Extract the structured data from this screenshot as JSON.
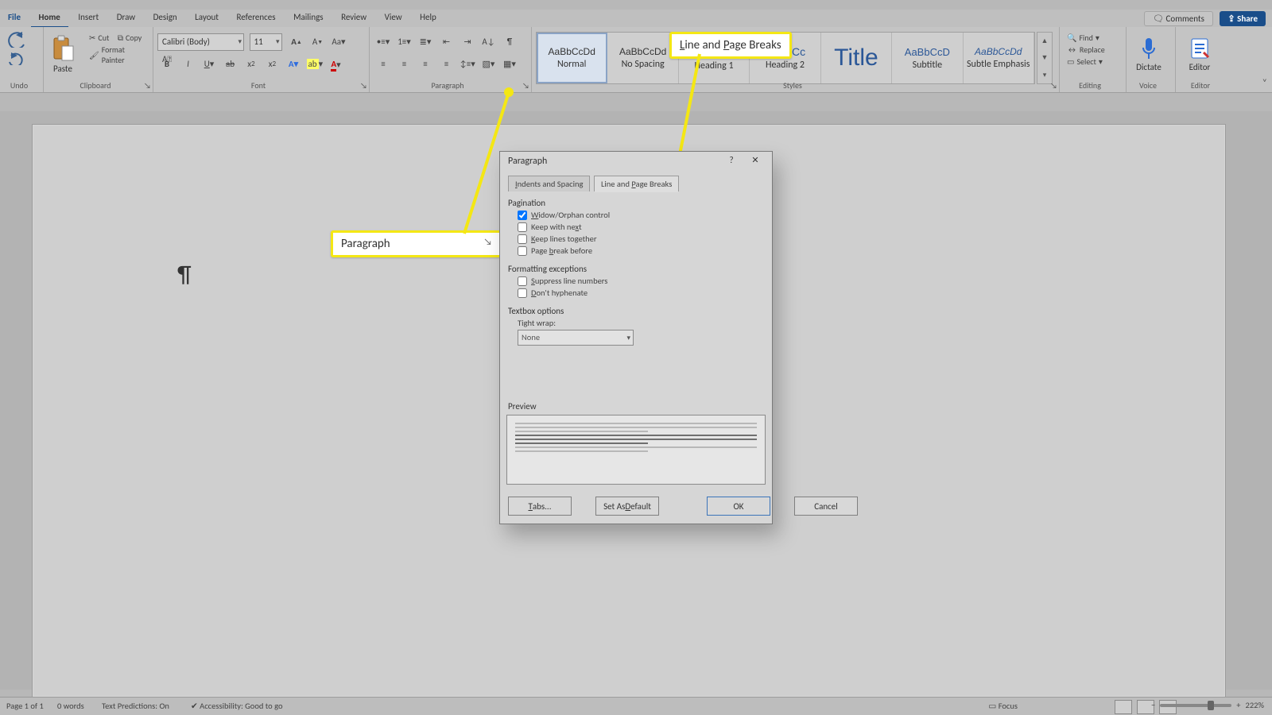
{
  "menu": {
    "file": "File",
    "home": "Home",
    "insert": "Insert",
    "draw": "Draw",
    "design": "Design",
    "layout": "Layout",
    "references": "References",
    "mailings": "Mailings",
    "review": "Review",
    "view": "View",
    "help": "Help"
  },
  "top_actions": {
    "comments": "Comments",
    "share": "Share"
  },
  "ribbon": {
    "undo_label": "Undo",
    "clipboard": {
      "paste": "Paste",
      "cut": "Cut",
      "copy": "Copy",
      "fmtpainter": "Format Painter",
      "label": "Clipboard"
    },
    "font": {
      "name": "Calibri (Body)",
      "size": "11",
      "label": "Font"
    },
    "paragraph": {
      "label": "Paragraph"
    },
    "styles": {
      "label": "Styles",
      "items": [
        {
          "name": "Normal"
        },
        {
          "name": "No Spacing"
        },
        {
          "name": "Heading 1"
        },
        {
          "name": "Heading 2"
        },
        {
          "name": "Title"
        },
        {
          "name": "Subtitle"
        },
        {
          "name": "Subtle Emphasis"
        }
      ]
    },
    "editing": {
      "find": "Find",
      "replace": "Replace",
      "select": "Select",
      "label": "Editing"
    },
    "voice": {
      "dictate": "Dictate",
      "label": "Voice"
    },
    "editor": {
      "editor": "Editor",
      "label": "Editor"
    }
  },
  "callouts": {
    "para": "Paragraph",
    "lpb": "Line and Page Breaks"
  },
  "dialog": {
    "title": "Paragraph",
    "tab1": "Indents and Spacing",
    "tab2": "Line and Page Breaks",
    "sect_pagination": "Pagination",
    "chk_widow": "Widow/Orphan control",
    "chk_keep_next": "Keep with next",
    "chk_keep_together": "Keep lines together",
    "chk_page_break": "Page break before",
    "sect_fmt": "Formatting exceptions",
    "chk_suppress": "Suppress line numbers",
    "chk_dont_hyph": "Don't hyphenate",
    "sect_textbox": "Textbox options",
    "tight_wrap_label": "Tight wrap:",
    "tight_wrap_value": "None",
    "preview_label": "Preview",
    "btn_tabs": "Tabs...",
    "btn_default": "Set As Default",
    "btn_ok": "OK",
    "btn_cancel": "Cancel"
  },
  "status": {
    "page": "Page 1 of 1",
    "words": "0 words",
    "predictions": "Text Predictions: On",
    "accessibility": "Accessibility: Good to go",
    "focus": "Focus",
    "zoom": "222%"
  }
}
